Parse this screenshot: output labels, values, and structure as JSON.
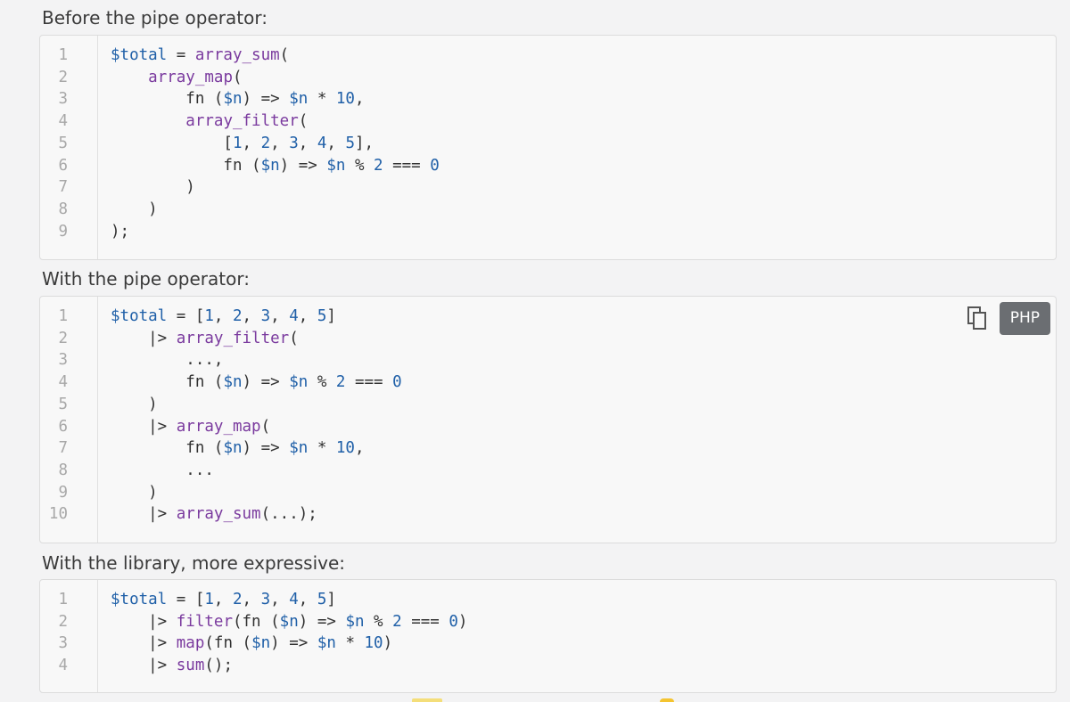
{
  "sections": [
    {
      "heading": "Before the pipe operator:",
      "lines": [
        {
          "n": "1",
          "tokens": [
            [
              "var",
              "$total"
            ],
            [
              "op",
              " = "
            ],
            [
              "fn",
              "array_sum"
            ],
            [
              "op",
              "("
            ]
          ]
        },
        {
          "n": "2",
          "tokens": [
            [
              "op",
              "    "
            ],
            [
              "fn",
              "array_map"
            ],
            [
              "op",
              "("
            ]
          ]
        },
        {
          "n": "3",
          "tokens": [
            [
              "op",
              "        fn ("
            ],
            [
              "var",
              "$n"
            ],
            [
              "op",
              ") => "
            ],
            [
              "var",
              "$n"
            ],
            [
              "op",
              " * "
            ],
            [
              "num",
              "10"
            ],
            [
              "op",
              ","
            ]
          ]
        },
        {
          "n": "4",
          "tokens": [
            [
              "op",
              "        "
            ],
            [
              "fn",
              "array_filter"
            ],
            [
              "op",
              "("
            ]
          ]
        },
        {
          "n": "5",
          "tokens": [
            [
              "op",
              "            ["
            ],
            [
              "num",
              "1"
            ],
            [
              "op",
              ", "
            ],
            [
              "num",
              "2"
            ],
            [
              "op",
              ", "
            ],
            [
              "num",
              "3"
            ],
            [
              "op",
              ", "
            ],
            [
              "num",
              "4"
            ],
            [
              "op",
              ", "
            ],
            [
              "num",
              "5"
            ],
            [
              "op",
              "],"
            ]
          ]
        },
        {
          "n": "6",
          "tokens": [
            [
              "op",
              "            fn ("
            ],
            [
              "var",
              "$n"
            ],
            [
              "op",
              ") => "
            ],
            [
              "var",
              "$n"
            ],
            [
              "op",
              " % "
            ],
            [
              "num",
              "2"
            ],
            [
              "op",
              " === "
            ],
            [
              "num",
              "0"
            ]
          ]
        },
        {
          "n": "7",
          "tokens": [
            [
              "op",
              "        )"
            ]
          ]
        },
        {
          "n": "8",
          "tokens": [
            [
              "op",
              "    )"
            ]
          ]
        },
        {
          "n": "9",
          "tokens": [
            [
              "op",
              ");"
            ]
          ]
        }
      ]
    },
    {
      "heading": "With the pipe operator:",
      "lines": [
        {
          "n": "1",
          "tokens": [
            [
              "var",
              "$total"
            ],
            [
              "op",
              " = ["
            ],
            [
              "num",
              "1"
            ],
            [
              "op",
              ", "
            ],
            [
              "num",
              "2"
            ],
            [
              "op",
              ", "
            ],
            [
              "num",
              "3"
            ],
            [
              "op",
              ", "
            ],
            [
              "num",
              "4"
            ],
            [
              "op",
              ", "
            ],
            [
              "num",
              "5"
            ],
            [
              "op",
              "]"
            ]
          ]
        },
        {
          "n": "2",
          "tokens": [
            [
              "op",
              "    |> "
            ],
            [
              "fn",
              "array_filter"
            ],
            [
              "op",
              "("
            ]
          ]
        },
        {
          "n": "3",
          "tokens": [
            [
              "op",
              "        ...,"
            ]
          ]
        },
        {
          "n": "4",
          "tokens": [
            [
              "op",
              "        fn ("
            ],
            [
              "var",
              "$n"
            ],
            [
              "op",
              ") => "
            ],
            [
              "var",
              "$n"
            ],
            [
              "op",
              " % "
            ],
            [
              "num",
              "2"
            ],
            [
              "op",
              " === "
            ],
            [
              "num",
              "0"
            ]
          ]
        },
        {
          "n": "5",
          "tokens": [
            [
              "op",
              "    )"
            ]
          ]
        },
        {
          "n": "6",
          "tokens": [
            [
              "op",
              "    |> "
            ],
            [
              "fn",
              "array_map"
            ],
            [
              "op",
              "("
            ]
          ]
        },
        {
          "n": "7",
          "tokens": [
            [
              "op",
              "        fn ("
            ],
            [
              "var",
              "$n"
            ],
            [
              "op",
              ") => "
            ],
            [
              "var",
              "$n"
            ],
            [
              "op",
              " * "
            ],
            [
              "num",
              "10"
            ],
            [
              "op",
              ","
            ]
          ]
        },
        {
          "n": "8",
          "tokens": [
            [
              "op",
              "        ..."
            ]
          ]
        },
        {
          "n": "9",
          "tokens": [
            [
              "op",
              "    )"
            ]
          ]
        },
        {
          "n": "10",
          "tokens": [
            [
              "op",
              "    |> "
            ],
            [
              "fn",
              "array_sum"
            ],
            [
              "op",
              "(...);"
            ]
          ]
        }
      ],
      "toolbar": {
        "copy_icon": "copy-icon",
        "language": "PHP"
      }
    },
    {
      "heading": "With the library, more expressive:",
      "lines": [
        {
          "n": "1",
          "tokens": [
            [
              "var",
              "$total"
            ],
            [
              "op",
              " = ["
            ],
            [
              "num",
              "1"
            ],
            [
              "op",
              ", "
            ],
            [
              "num",
              "2"
            ],
            [
              "op",
              ", "
            ],
            [
              "num",
              "3"
            ],
            [
              "op",
              ", "
            ],
            [
              "num",
              "4"
            ],
            [
              "op",
              ", "
            ],
            [
              "num",
              "5"
            ],
            [
              "op",
              "]"
            ]
          ]
        },
        {
          "n": "2",
          "tokens": [
            [
              "op",
              "    |> "
            ],
            [
              "fn",
              "filter"
            ],
            [
              "op",
              "(fn ("
            ],
            [
              "var",
              "$n"
            ],
            [
              "op",
              ") => "
            ],
            [
              "var",
              "$n"
            ],
            [
              "op",
              " % "
            ],
            [
              "num",
              "2"
            ],
            [
              "op",
              " === "
            ],
            [
              "num",
              "0"
            ],
            [
              "op",
              ")"
            ]
          ]
        },
        {
          "n": "3",
          "tokens": [
            [
              "op",
              "    |> "
            ],
            [
              "fn",
              "map"
            ],
            [
              "op",
              "(fn ("
            ],
            [
              "var",
              "$n"
            ],
            [
              "op",
              ") => "
            ],
            [
              "var",
              "$n"
            ],
            [
              "op",
              " * "
            ],
            [
              "num",
              "10"
            ],
            [
              "op",
              ")"
            ]
          ]
        },
        {
          "n": "4",
          "tokens": [
            [
              "op",
              "    |> "
            ],
            [
              "fn",
              "sum"
            ],
            [
              "op",
              "();"
            ]
          ]
        }
      ]
    }
  ]
}
